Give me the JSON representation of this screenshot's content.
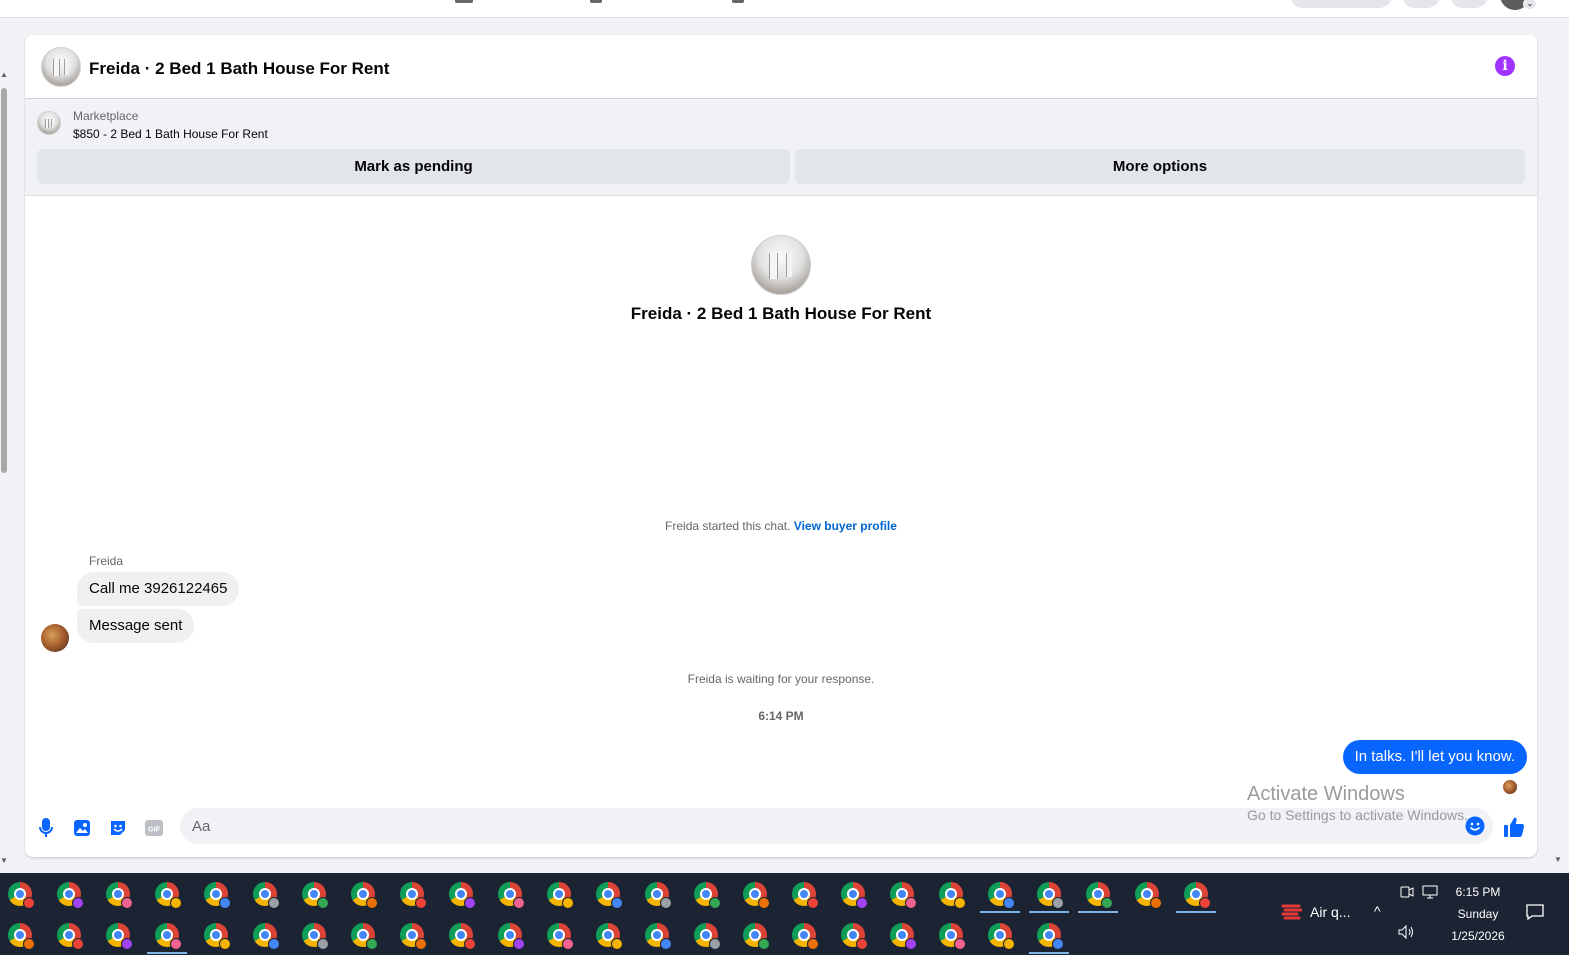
{
  "header": {
    "title": "Freida · 2 Bed 1 Bath House For Rent",
    "info_icon": "i"
  },
  "marketplace": {
    "label": "Marketplace",
    "listing": "$850 - 2 Bed 1 Bath House For Rent",
    "pending_label": "Mark as pending",
    "more_label": "More options"
  },
  "conversation": {
    "intro_title": "Freida · 2 Bed 1 Bath House For Rent",
    "started_text": "Freida started this chat. ",
    "view_profile": "View buyer profile",
    "sender_name": "Freida",
    "incoming": [
      "Call me 3926122465",
      "Message sent"
    ],
    "waiting": "Freida is waiting for your response.",
    "timestamp": "6:14 PM",
    "outgoing": "In talks. I'll let you know."
  },
  "composer": {
    "placeholder": "Aa",
    "icons": [
      "microphone-icon",
      "photo-icon",
      "sticker-icon",
      "gif-icon",
      "emoji-icon",
      "thumbs-up-icon"
    ]
  },
  "watermark": {
    "title": "Activate Windows",
    "subtitle": "Go to Settings to activate Windows."
  },
  "taskbar": {
    "weather": "Air q...",
    "time": "6:15 PM",
    "day": "Sunday",
    "date": "1/25/2026",
    "badge_colors": [
      "#ea4335",
      "#f4b400",
      "#34a853",
      "#a142f4",
      "#4285f4",
      "#e8710a",
      "#f06292",
      "#9aa0a6"
    ]
  }
}
